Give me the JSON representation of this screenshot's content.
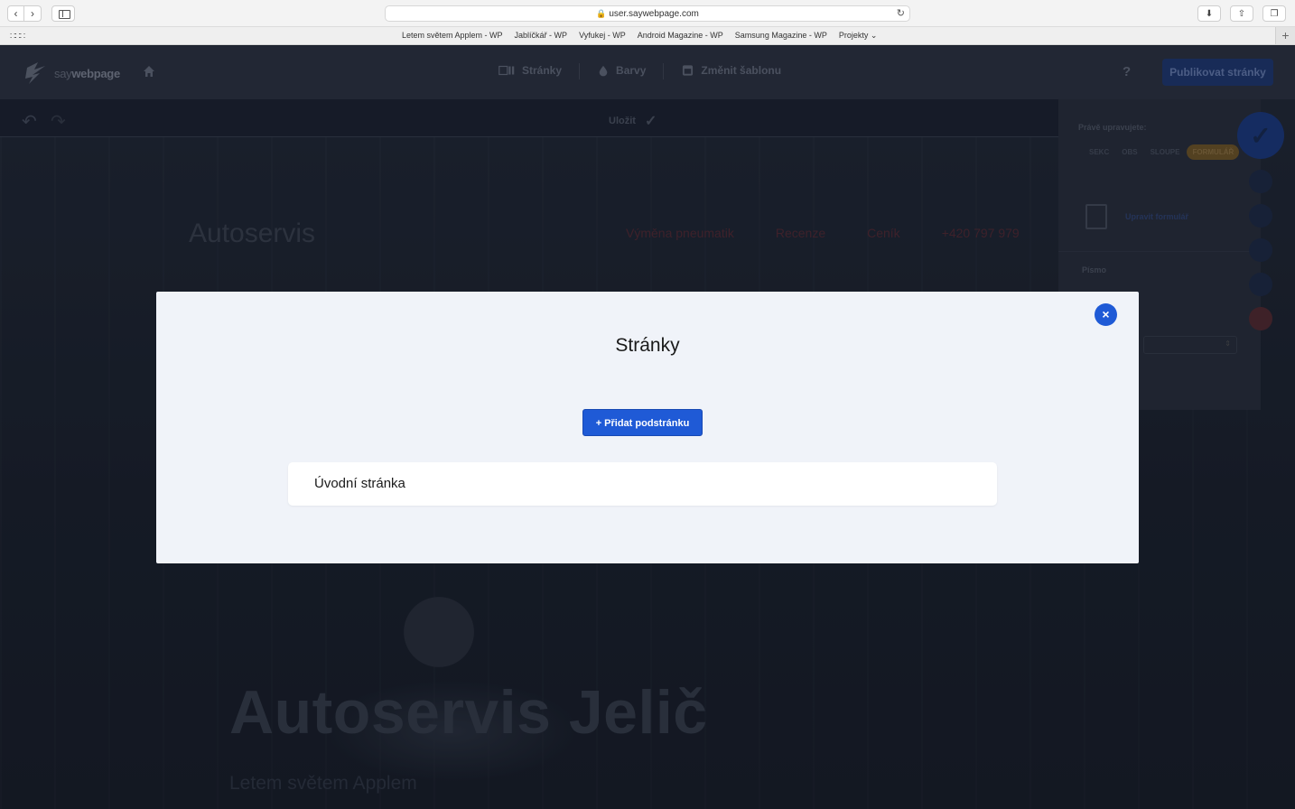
{
  "browser": {
    "url": "user.saywebpage.com",
    "bookmarks": [
      "Letem světem Applem - WP",
      "Jablíčkář - WP",
      "Vyfukej - WP",
      "Android Magazine - WP",
      "Samsung Magazine - WP",
      "Projekty"
    ]
  },
  "app": {
    "logo": {
      "say": "say",
      "webpage": "webpage"
    },
    "toolbar": {
      "pages": "Stránky",
      "colors": "Barvy",
      "template": "Změnit šablonu"
    },
    "help": "?",
    "publish": "Publikovat stránky",
    "save": "Uložit"
  },
  "site": {
    "brand": "Autoservis",
    "nav": [
      "Výměna pneumatik",
      "Recenze",
      "Ceník",
      "+420 797 979"
    ],
    "hero_title": "Autoservis Jelič",
    "hero_subtitle": "Letem světem Applem"
  },
  "panel": {
    "editing_label": "Právě upravujete:",
    "chips": [
      "SEKC",
      "OBS",
      "SLOUPE",
      "FORMULÁŘ"
    ],
    "edit_form": "Upravit formulář",
    "font_label": "Písmo"
  },
  "modal": {
    "title": "Stránky",
    "add_button": "+ Přidat podstránku",
    "pages": [
      "Úvodní stránka"
    ],
    "close": "×"
  }
}
